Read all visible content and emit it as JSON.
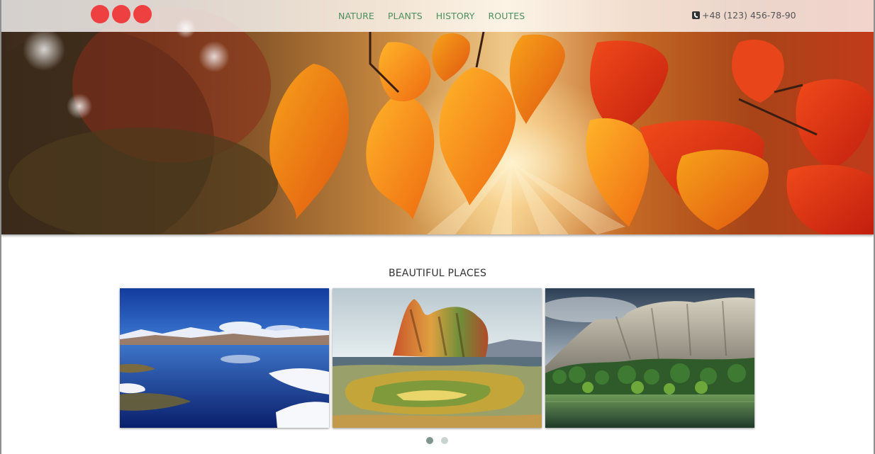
{
  "header": {
    "logo_dots": 3,
    "logo_color": "#ee4040",
    "nav": [
      {
        "label": "NATURE"
      },
      {
        "label": "PLANTS"
      },
      {
        "label": "HISTORY"
      },
      {
        "label": "ROUTES"
      }
    ],
    "nav_color": "#4e8f5e",
    "phone": "+48 (123) 456-78-90",
    "phone_icon": "phone-icon"
  },
  "hero": {
    "image": "autumn-leaves-photo"
  },
  "gallery": {
    "title": "BEAUTIFUL PLACES",
    "items": [
      {
        "image": "mountain-lake-photo"
      },
      {
        "image": "geyser-photo"
      },
      {
        "image": "valley-cliffs-photo"
      }
    ],
    "pager": {
      "count": 2,
      "active": 1
    }
  }
}
